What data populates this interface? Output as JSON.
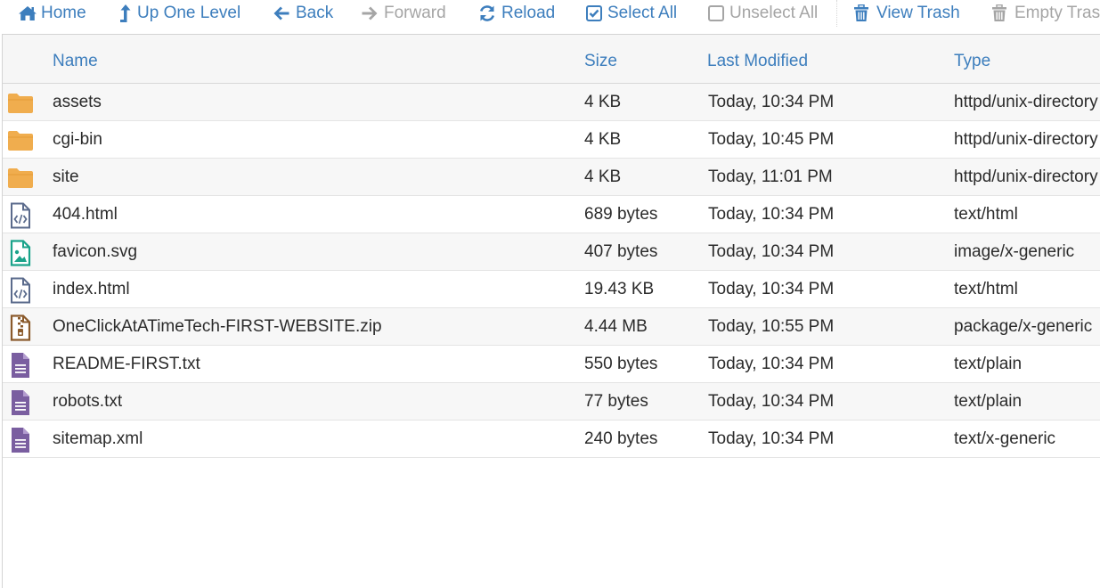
{
  "toolbar": {
    "home": "Home",
    "up_one_level": "Up One Level",
    "back": "Back",
    "forward": "Forward",
    "reload": "Reload",
    "select_all": "Select All",
    "unselect_all": "Unselect All",
    "view_trash": "View Trash",
    "empty_trash": "Empty Trash"
  },
  "table": {
    "columns": {
      "name": "Name",
      "size": "Size",
      "last_modified": "Last Modified",
      "type": "Type"
    },
    "rows": [
      {
        "icon": "folder-icon",
        "name": "assets",
        "size": "4 KB",
        "modified": "Today, 10:34 PM",
        "type": "httpd/unix-directory"
      },
      {
        "icon": "folder-icon",
        "name": "cgi-bin",
        "size": "4 KB",
        "modified": "Today, 10:45 PM",
        "type": "httpd/unix-directory"
      },
      {
        "icon": "folder-icon",
        "name": "site",
        "size": "4 KB",
        "modified": "Today, 11:01 PM",
        "type": "httpd/unix-directory"
      },
      {
        "icon": "code-file-icon",
        "name": "404.html",
        "size": "689 bytes",
        "modified": "Today, 10:34 PM",
        "type": "text/html"
      },
      {
        "icon": "image-file-icon",
        "name": "favicon.svg",
        "size": "407 bytes",
        "modified": "Today, 10:34 PM",
        "type": "image/x-generic"
      },
      {
        "icon": "code-file-icon",
        "name": "index.html",
        "size": "19.43 KB",
        "modified": "Today, 10:34 PM",
        "type": "text/html"
      },
      {
        "icon": "zip-file-icon",
        "name": "OneClickAtATimeTech-FIRST-WEBSITE.zip",
        "size": "4.44 MB",
        "modified": "Today, 10:55 PM",
        "type": "package/x-generic"
      },
      {
        "icon": "text-file-icon",
        "name": "README-FIRST.txt",
        "size": "550 bytes",
        "modified": "Today, 10:34 PM",
        "type": "text/plain"
      },
      {
        "icon": "text-file-icon",
        "name": "robots.txt",
        "size": "77 bytes",
        "modified": "Today, 10:34 PM",
        "type": "text/plain"
      },
      {
        "icon": "text-file-icon",
        "name": "sitemap.xml",
        "size": "240 bytes",
        "modified": "Today, 10:34 PM",
        "type": "text/x-generic"
      }
    ]
  },
  "colors": {
    "accent": "#3d7ebd",
    "disabled": "#a5a5a5",
    "folder": "#f0ad4e",
    "code_file": "#5b6b8c",
    "image_file": "#1aa38a",
    "zip_file": "#8a5a2b",
    "text_file": "#7a5ea0"
  }
}
